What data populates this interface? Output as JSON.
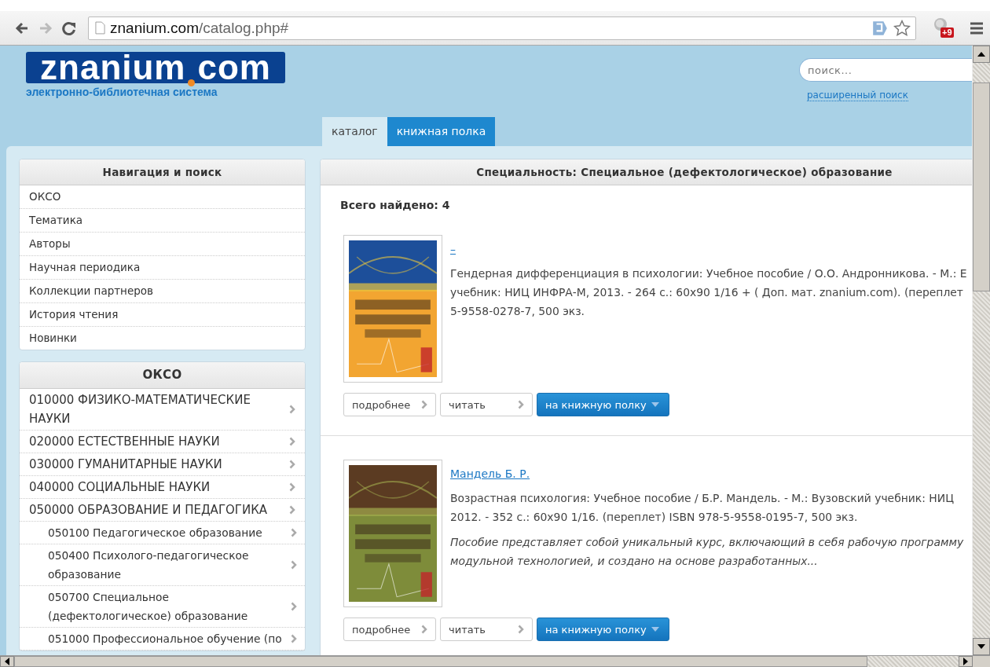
{
  "browser": {
    "url_domain": "znanium.com",
    "url_path": "/catalog.php#",
    "forward_disabled": true,
    "extension_badge": "+9"
  },
  "header": {
    "logo_left": "znanium",
    "logo_right": "com",
    "tagline": "электронно-библиотечная система",
    "search": {
      "placeholder": "поиск..."
    },
    "advanced_search": "расширенный поиск"
  },
  "tabs": [
    {
      "label": "каталог",
      "selected": true
    },
    {
      "label": "книжная полка",
      "selected": false
    }
  ],
  "nav_panel": {
    "title": "Навигация и поиск",
    "items": [
      "ОКСО",
      "Тематика",
      "Авторы",
      "Научная периодика",
      "Коллекции партнеров",
      "История чтения",
      "Новинки"
    ]
  },
  "okso_panel": {
    "title": "ОКСО",
    "items": [
      {
        "label": "010000 ФИЗИКО-МАТЕМАТИЧЕСКИЕ НАУКИ"
      },
      {
        "label": "020000 ЕСТЕСТВЕННЫЕ НАУКИ"
      },
      {
        "label": "030000 ГУМАНИТАРНЫЕ НАУКИ"
      },
      {
        "label": "040000 СОЦИАЛЬНЫЕ НАУКИ"
      },
      {
        "label": "050000 ОБРАЗОВАНИЕ И ПЕДАГОГИКА",
        "children": [
          {
            "label": "050100 Педагогическое образование"
          },
          {
            "label": "050400 Психолого-педагогическое образование"
          },
          {
            "label": "050700 Специальное (дефектологическое) образование"
          },
          {
            "label": "051000 Профессиональное обучение (по"
          }
        ]
      }
    ]
  },
  "results": {
    "title": "Специальность: Специальное (дефектологическое) образование",
    "found": "Всего найдено: 4",
    "books": [
      {
        "author": "–",
        "description": [
          "Гендерная дифференциация в психологии: Учебное пособие / О.О. Андронникова. - М.: Е",
          "учебник: НИЦ ИНФРА-М, 2013. - 264 с.: 60х90 1/16 + ( Доп. мат. znanium.com). (переплет",
          "5-9558-0278-7, 500 экз."
        ],
        "buttons": [
          "подробнее",
          "читать"
        ],
        "shelf_button": "на книжную полку"
      },
      {
        "author": "Мандель Б. Р.",
        "description": [
          "Возрастная психология: Учебное пособие / Б.Р. Мандель. - М.: Вузовский учебник: НИЦ",
          "2012. - 352 с.: 60х90 1/16. (переплет) ISBN 978-5-9558-0195-7, 500 экз."
        ],
        "annotation": [
          "Пособие представляет собой уникальный курс, включающий в себя рабочую программу",
          "модульной технологией, и создано на основе разработанных..."
        ],
        "buttons": [
          "подробнее",
          "читать"
        ],
        "shelf_button": "на книжную полку"
      }
    ]
  }
}
